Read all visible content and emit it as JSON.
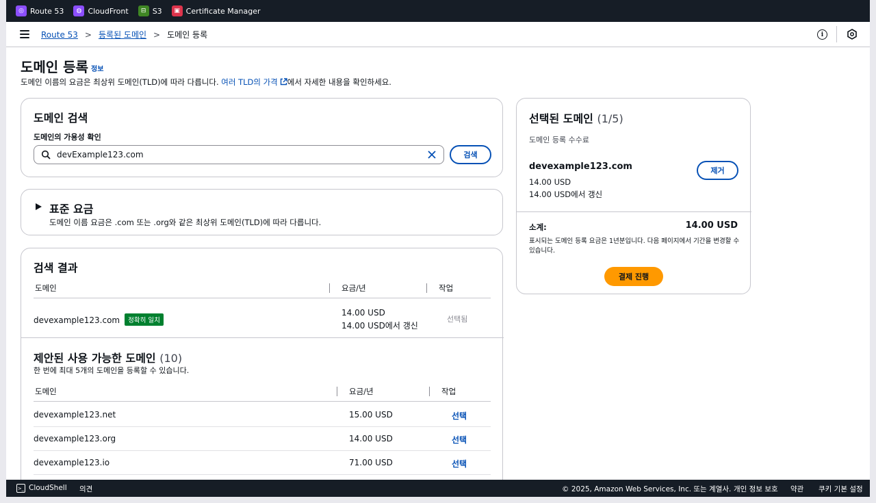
{
  "favorites": [
    {
      "label": "Route 53",
      "color": "#8c4fff",
      "icon": "route53-icon"
    },
    {
      "label": "CloudFront",
      "color": "#8c4fff",
      "icon": "cloudfront-icon"
    },
    {
      "label": "S3",
      "color": "#3f8624",
      "icon": "s3-icon"
    },
    {
      "label": "Certificate Manager",
      "color": "#dd344c",
      "icon": "certificate-manager-icon"
    }
  ],
  "breadcrumb": {
    "root": "Route 53",
    "parent": "등록된 도메인",
    "current": "도메인 등록"
  },
  "header": {
    "title": "도메인 등록",
    "info": "정보",
    "desc_pre": "도메인 이름의 요금은 최상위 도메인(TLD)에 따라 다릅니다. ",
    "desc_link": "여러 TLD의 가격",
    "desc_post": "에서 자세한 내용을 확인하세요."
  },
  "search": {
    "title": "도메인 검색",
    "label": "도메인의 가용성 확인",
    "value": "devExample123.com",
    "button": "검색"
  },
  "standard": {
    "title": "표준 요금",
    "desc": "도메인 이름 요금은 .com 또는 .org와 같은 최상위 도메인(TLD)에 따라 다릅니다."
  },
  "results": {
    "title": "검색 결과",
    "col_domain": "도메인",
    "col_price": "요금/년",
    "col_action": "작업",
    "row": {
      "domain": "devexample123.com",
      "badge": "정확히 일치",
      "price": "14.00 USD",
      "renew": "14.00 USD에서 갱신",
      "action": "선택됨"
    }
  },
  "suggested": {
    "title": "제안된 사용 가능한 도메인",
    "count": "(10)",
    "desc": "한 번에 최대 5개의 도메인을 등록할 수 있습니다.",
    "col_domain": "도메인",
    "col_price": "요금/년",
    "col_action": "작업",
    "rows": [
      {
        "domain": "devexample123.net",
        "price": "15.00 USD",
        "action": "선택"
      },
      {
        "domain": "devexample123.org",
        "price": "14.00 USD",
        "action": "선택"
      },
      {
        "domain": "devexample123.io",
        "price": "71.00 USD",
        "action": "선택"
      }
    ]
  },
  "selected": {
    "title": "선택된 도메인",
    "count": "(1/5)",
    "fee_label": "도메인 등록 수수료",
    "domain": "devexample123.com",
    "price": "14.00 USD",
    "renew": "14.00 USD에서 갱신",
    "remove": "제거",
    "subtotal_label": "소계:",
    "subtotal": "14.00 USD",
    "note": "표시되는 도메인 등록 요금은 1년분입니다. 다음 페이지에서 기간을 변경할 수 있습니다.",
    "pay": "결제 진행"
  },
  "footer": {
    "cloudshell": "CloudShell",
    "feedback": "의견",
    "copyright": "© 2025, Amazon Web Services, Inc. 또는 계열사.",
    "privacy": "개인 정보 보호",
    "terms": "약관",
    "cookies": "쿠키 기본 설정"
  }
}
